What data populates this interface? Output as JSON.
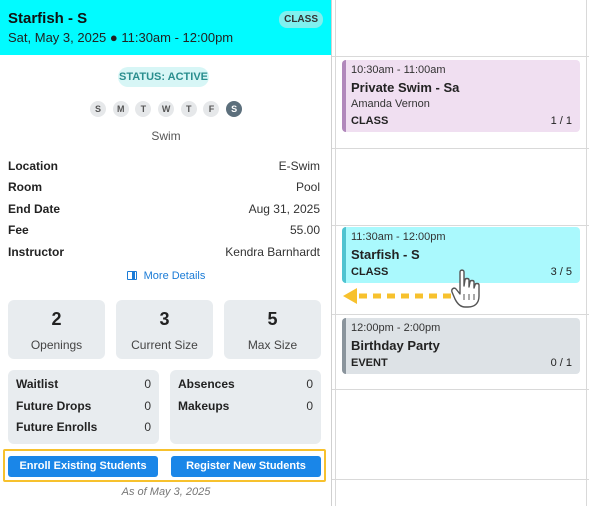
{
  "panel": {
    "title": "Starfish - S",
    "datetime": "Sat, May 3, 2025 ● 11:30am - 12:00pm",
    "type_badge": "CLASS",
    "status": "STATUS: ACTIVE",
    "days": [
      {
        "letter": "S",
        "active": false
      },
      {
        "letter": "M",
        "active": false
      },
      {
        "letter": "T",
        "active": false
      },
      {
        "letter": "W",
        "active": false
      },
      {
        "letter": "T",
        "active": false
      },
      {
        "letter": "F",
        "active": false
      },
      {
        "letter": "S",
        "active": true
      }
    ],
    "activity": "Swim",
    "details": [
      {
        "label": "Location",
        "value": "E-Swim"
      },
      {
        "label": "Room",
        "value": "Pool"
      },
      {
        "label": "End Date",
        "value": "Aug 31, 2025"
      },
      {
        "label": "Fee",
        "value": "55.00"
      },
      {
        "label": "Instructor",
        "value": "Kendra Barnhardt"
      }
    ],
    "more_details": "More Details",
    "stats": [
      {
        "value": "2",
        "label": "Openings"
      },
      {
        "value": "3",
        "label": "Current Size"
      },
      {
        "value": "5",
        "label": "Max Size"
      }
    ],
    "left_box": [
      {
        "label": "Waitlist",
        "value": "0"
      },
      {
        "label": "Future Drops",
        "value": "0"
      },
      {
        "label": "Future Enrolls",
        "value": "0"
      }
    ],
    "right_box": [
      {
        "label": "Absences",
        "value": "0"
      },
      {
        "label": "Makeups",
        "value": "0"
      }
    ],
    "enroll_button": "Enroll Existing Students",
    "register_button": "Register New Students",
    "as_of": "As of May 3, 2025"
  },
  "calendar": {
    "events": [
      {
        "time": "10:30am - 11:00am",
        "title": "Private Swim - Sa",
        "instructor": "Amanda Vernon",
        "type": "CLASS",
        "count": "1 / 1"
      },
      {
        "time": "11:30am - 12:00pm",
        "title": "Starfish - S",
        "type": "CLASS",
        "count": "3 / 5"
      },
      {
        "time": "12:00pm - 2:00pm",
        "title": "Birthday Party",
        "type": "EVENT",
        "count": "0 / 1"
      }
    ]
  },
  "colors": {
    "header_bg": "#01fbff",
    "accent_blue": "#1a86e8",
    "highlight": "#f7c12d",
    "private_event": "#f0dff1",
    "starfish_event": "#aaf9fd",
    "birthday_event": "#dde2e6"
  },
  "icons": {
    "more_details": "panel-icon",
    "cursor": "hand-pointer-icon",
    "arrow": "dashed-arrow-left-icon"
  }
}
